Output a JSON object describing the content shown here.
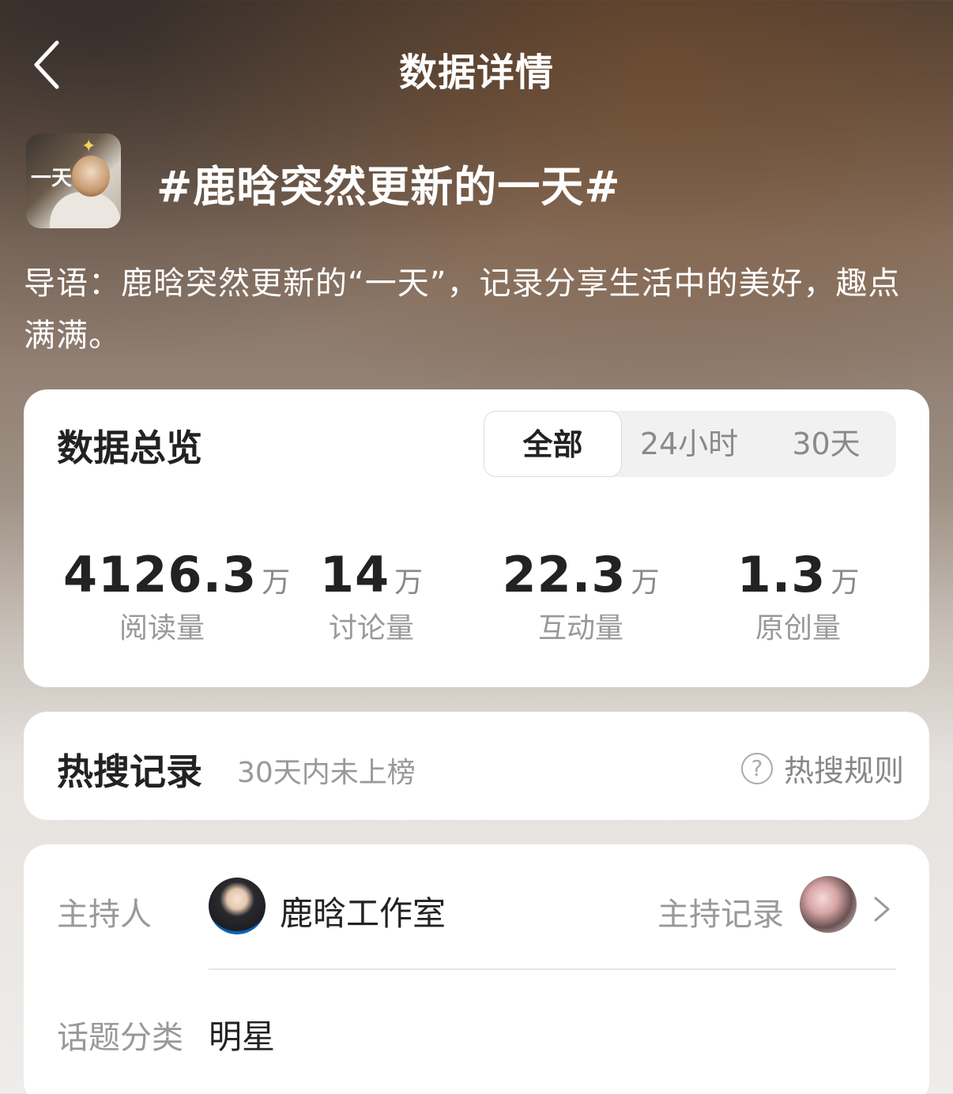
{
  "header": {
    "title": "数据详情"
  },
  "topic": {
    "thumb_text": "一天",
    "title": "#鹿晗突然更新的一天#",
    "intro": "导语：鹿晗突然更新的“一天”，记录分享生活中的美好，趣点满满。"
  },
  "overview": {
    "title": "数据总览",
    "tabs": [
      {
        "label": "全部",
        "active": true
      },
      {
        "label": "24小时",
        "active": false
      },
      {
        "label": "30天",
        "active": false
      }
    ],
    "stats": [
      {
        "value": "4126.3",
        "unit": "万",
        "label": "阅读量"
      },
      {
        "value": "14",
        "unit": "万",
        "label": "讨论量"
      },
      {
        "value": "22.3",
        "unit": "万",
        "label": "互动量"
      },
      {
        "value": "1.3",
        "unit": "万",
        "label": "原创量"
      }
    ]
  },
  "hot_search": {
    "title": "热搜记录",
    "subtitle": "30天内未上榜",
    "rule_icon": "question-circle-icon",
    "rule_label": "热搜规则"
  },
  "info": {
    "host_label": "主持人",
    "host_name": "鹿晗工作室",
    "host_record_label": "主持记录",
    "category_label": "话题分类",
    "category_value": "明星"
  },
  "colors": {
    "card_bg": "#ffffff",
    "primary_text": "#222222",
    "secondary_text": "#999999",
    "header_text": "#ffffff"
  }
}
